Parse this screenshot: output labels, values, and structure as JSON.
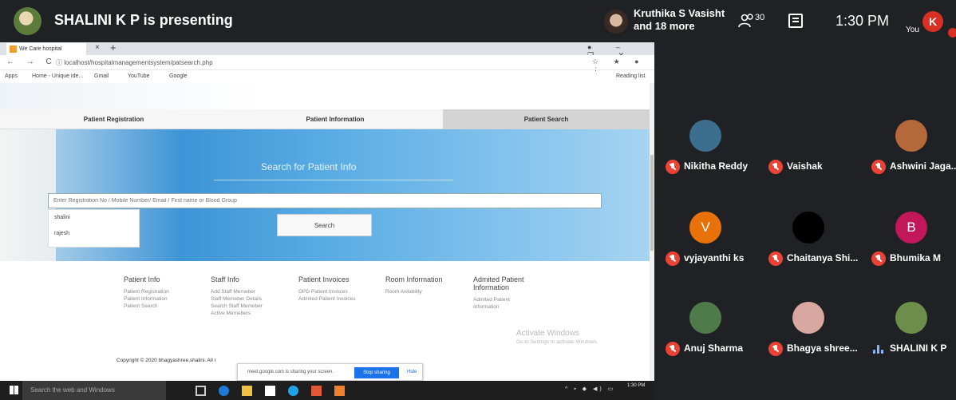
{
  "meet": {
    "presenting_text": "SHALINI K P is presenting",
    "others_line1": "Kruthika S Vasisht",
    "others_line2": "and 18 more",
    "people_count": "30",
    "time": "1:30 PM",
    "you_label": "You",
    "you_initial": "K",
    "accent_red": "#d93025"
  },
  "browser": {
    "tab_title": "We Care hospital",
    "tab_close": "×",
    "tab_new": "+",
    "window_controls": "● – ❐ ✕",
    "nav_buttons": "← → C",
    "url": "ⓘ localhost/hospitalmanagementsystem/patsearch.php",
    "bookmarks": [
      "Apps",
      "Home - Unique ide...",
      "Gmail",
      "YouTube",
      "Google"
    ],
    "reading_list": "Reading list"
  },
  "page": {
    "nav_tabs": [
      "Patient Registration",
      "Patient Information",
      "Patient Search"
    ],
    "active_tab": "Patient Search",
    "hero_title": "Search for Patient Info",
    "search_placeholder": "Enter Registration No / Mobile Number/ Email / First name or Blood Group",
    "suggestions": [
      "shalini",
      "rajesh"
    ],
    "search_button": "Search",
    "footer_columns": [
      {
        "title": "Patient Info",
        "links": [
          "Patient Registration",
          "Patient Information",
          "Patient Search"
        ]
      },
      {
        "title": "Staff Info",
        "links": [
          "Add Staff Memeber",
          "Staff Memeber Details",
          "Search Staff Memeber",
          "Active Memebers"
        ]
      },
      {
        "title": "Patient Invoices",
        "links": [
          "OPD Patient Invoices",
          "Admited Patient Invoices"
        ]
      },
      {
        "title": "Room Information",
        "links": [
          "Room Avilability"
        ]
      },
      {
        "title": "Admited Patient Information",
        "links": [
          "Admited Patient Information"
        ]
      }
    ],
    "copyright": "Copyright © 2020 bhagyashree,shalini. All r",
    "watermark_title": "Activate Windows",
    "watermark_sub": "Go to Settings to activate Windows."
  },
  "share_popup": {
    "text": "meet.google.com is sharing your screen.",
    "stop_label": "Stop sharing",
    "hide_label": "Hide"
  },
  "taskbar": {
    "search_placeholder": "Search the web and Windows",
    "time": "1:30 PM"
  },
  "participants": [
    {
      "name": "Nikitha Reddy",
      "initial": "",
      "color": "#3b6e8f",
      "muted": true
    },
    {
      "name": "Vaishak",
      "initial": "",
      "color": "#202124",
      "muted": true
    },
    {
      "name": "Ashwini Jaga...",
      "initial": "",
      "color": "#b5683a",
      "muted": true
    },
    {
      "name": "vyjayanthi ks",
      "initial": "V",
      "color": "#e8710a",
      "muted": true
    },
    {
      "name": "Chaitanya Shi...",
      "initial": "",
      "color": "#000000",
      "muted": true
    },
    {
      "name": "Bhumika M",
      "initial": "B",
      "color": "#c2185b",
      "muted": true
    },
    {
      "name": "Anuj Sharma",
      "initial": "",
      "color": "#4f7a4a",
      "muted": true
    },
    {
      "name": "Bhagya shree...",
      "initial": "",
      "color": "#d8a8a0",
      "muted": true
    },
    {
      "name": "SHALINI K P",
      "initial": "",
      "color": "#6b8f4a",
      "muted": false
    }
  ]
}
